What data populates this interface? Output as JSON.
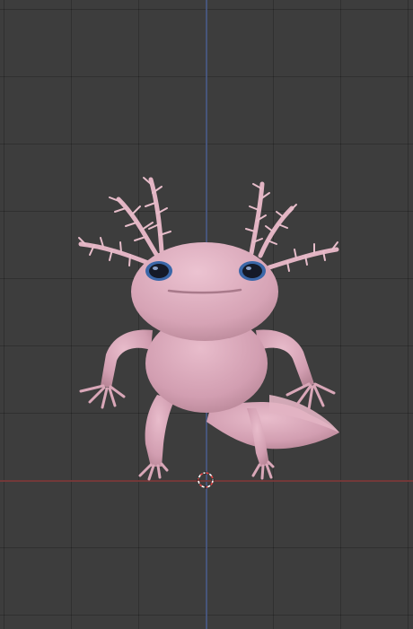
{
  "viewport": {
    "background_color": "#3d3d3d",
    "grid_color": "#2f2f2f",
    "axis_x_color": "#7a3a3a",
    "axis_y_color": "#4a5a86"
  },
  "model": {
    "name_icon": "axolotl-model",
    "body_color": "#d9a7b8",
    "shadow_color": "#b98798",
    "gill_color": "#e2b4c3",
    "eye_color": "#2f3f6a"
  },
  "cursor": {
    "icon": "3d-cursor-icon",
    "primary_color": "#ffffff",
    "secondary_color": "#e04040"
  }
}
